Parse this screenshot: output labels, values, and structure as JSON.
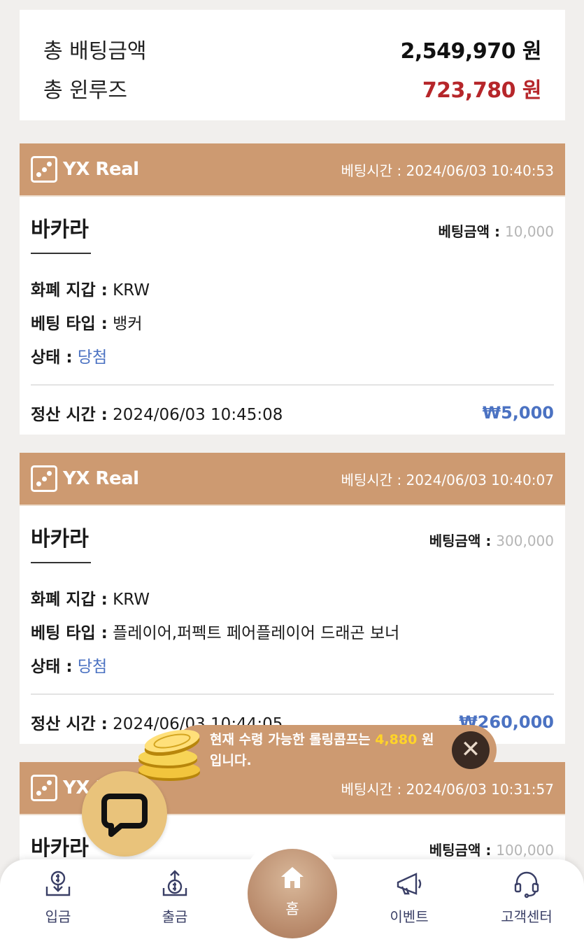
{
  "summary": {
    "total_bet_label": "총 배팅금액",
    "total_bet_value": "2,549,970 원",
    "total_win_label": "총 윈루즈",
    "total_win_value": "723,780 원"
  },
  "colors": {
    "accent": "#cd9a71",
    "win_blue": "#4b72c2",
    "loss_red": "#b6262a",
    "highlight": "#ffd428"
  },
  "bets": [
    {
      "brand": "YX Real",
      "bet_time": "베팅시간 : 2024/06/03 10:40:53",
      "game": "바카라",
      "amount_label": "베팅금액 :",
      "amount": "10,000",
      "wallet_label": "화폐 지갑 :",
      "wallet": "KRW",
      "type_label": "베팅 타입 :",
      "type": "뱅커",
      "status_label": "상태 :",
      "status": "당첨",
      "settle_label": "정산 시간 :",
      "settle_time": "2024/06/03 10:45:08",
      "payout": "₩5,000"
    },
    {
      "brand": "YX Real",
      "bet_time": "베팅시간 : 2024/06/03 10:40:07",
      "game": "바카라",
      "amount_label": "베팅금액 :",
      "amount": "300,000",
      "wallet_label": "화폐 지갑 :",
      "wallet": "KRW",
      "type_label": "베팅 타입 :",
      "type": "플레이어,퍼펙트 페어플레이어 드래곤 보너",
      "status_label": "상태 :",
      "status": "당첨",
      "settle_label": "정산 시간 :",
      "settle_time": "2024/06/03 10:44:05",
      "payout": "₩260,000"
    },
    {
      "brand": "YX Real",
      "bet_time": "베팅시간 : 2024/06/03 10:31:57",
      "game": "바카라",
      "amount_label": "베팅금액 :",
      "amount": "100,000"
    }
  ],
  "toast": {
    "text_before": "현재 수령 가능한 롤링콤프는 ",
    "value": "4,880",
    "text_unit": " 원",
    "text_line2": "입니다.",
    "close_icon": "close-icon"
  },
  "nav": {
    "deposit": "입금",
    "withdraw": "출금",
    "home": "홈",
    "event": "이벤트",
    "support": "고객센터"
  }
}
